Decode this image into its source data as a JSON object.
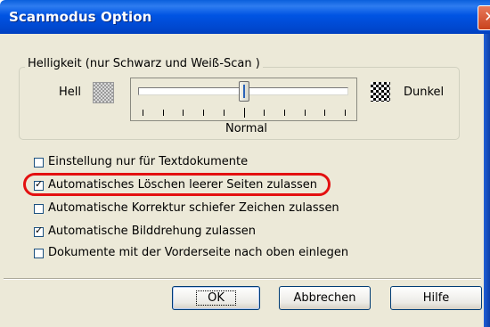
{
  "window": {
    "title": "Scanmodus Option",
    "close_symbol": "✕"
  },
  "brightness": {
    "group_label": "Helligkeit (nur Schwarz und Weiß-Scan )",
    "light_label": "Hell",
    "dark_label": "Dunkel",
    "current_label": "Normal",
    "slider_level": 0.5,
    "tick_count": 11
  },
  "options": [
    {
      "label": "Einstellung nur für Textdokumente",
      "checked": false
    },
    {
      "label": "Automatisches Löschen leerer Seiten zulassen",
      "checked": true,
      "highlighted": true
    },
    {
      "label": "Automatische Korrektur schiefer Zeichen zulassen",
      "checked": false
    },
    {
      "label": "Automatische Bilddrehung zulassen",
      "checked": true
    },
    {
      "label": "Dokumente mit der Vorderseite nach oben einlegen",
      "checked": false
    }
  ],
  "buttons": {
    "ok": "OK",
    "cancel": "Abbrechen",
    "help": "Hilfe"
  },
  "colors": {
    "title_bar": "#0054e3",
    "dialog_background": "#ece9d8",
    "highlight": "#e31010"
  }
}
